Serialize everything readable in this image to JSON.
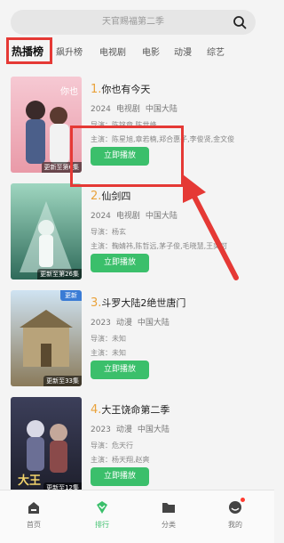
{
  "search": {
    "placeholder": "天官赐福第二季"
  },
  "tabs": [
    {
      "label": "热播榜",
      "active": true
    },
    {
      "label": "飙升榜"
    },
    {
      "label": "电视剧"
    },
    {
      "label": "电影"
    },
    {
      "label": "动漫"
    },
    {
      "label": "综艺"
    }
  ],
  "items": [
    {
      "rank": "1.",
      "title": "你也有今天",
      "year": "2024",
      "category": "电视剧",
      "region": "中国大陆",
      "director": "导演：陈铭章,陈世峰",
      "cast": "主演：陈星旭,章若楠,郑合惠子,李俊贤,金文俊",
      "badge": "更新至第6集",
      "play_label": "立即播放"
    },
    {
      "rank": "2.",
      "title": "仙剑四",
      "year": "2024",
      "category": "电视剧",
      "region": "中国大陆",
      "director": "导演：杨玄",
      "cast": "主演：鞠婧祎,陈哲远,茅子俊,毛晓慧,王奕可",
      "badge": "更新至第26集",
      "play_label": "立即播放"
    },
    {
      "rank": "3.",
      "title": "斗罗大陆2绝世唐门",
      "year": "2023",
      "category": "动漫",
      "region": "中国大陆",
      "director": "导演：未知",
      "cast": "主演：未知",
      "badge": "更新至33集",
      "new_tag": "更新",
      "play_label": "立即播放"
    },
    {
      "rank": "4.",
      "title": "大王饶命第二季",
      "year": "2023",
      "category": "动漫",
      "region": "中国大陆",
      "director": "导演：危天行",
      "cast": "主演：杨天翔,赵爽",
      "badge": "更新至12集",
      "play_label": "立即播放"
    }
  ],
  "nav": [
    {
      "label": "首页",
      "icon": "home-icon"
    },
    {
      "label": "排行",
      "icon": "rank-diamond-icon",
      "active": true
    },
    {
      "label": "分类",
      "icon": "folder-icon"
    },
    {
      "label": "我的",
      "icon": "profile-icon"
    }
  ],
  "colors": {
    "accent": "#3bbf6b",
    "highlight": "#e53935",
    "rank": "#e9a23b"
  }
}
